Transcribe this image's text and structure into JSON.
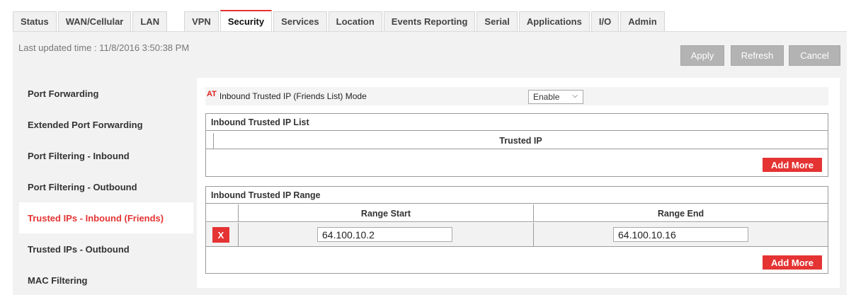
{
  "tabs": [
    {
      "label": "Status"
    },
    {
      "label": "WAN/Cellular"
    },
    {
      "label": "LAN"
    },
    {
      "label": "VPN"
    },
    {
      "label": "Security"
    },
    {
      "label": "Services"
    },
    {
      "label": "Location"
    },
    {
      "label": "Events Reporting"
    },
    {
      "label": "Serial"
    },
    {
      "label": "Applications"
    },
    {
      "label": "I/O"
    },
    {
      "label": "Admin"
    }
  ],
  "header": {
    "last_updated": "Last updated time : 11/8/2016 3:50:38 PM",
    "apply_label": "Apply",
    "refresh_label": "Refresh",
    "cancel_label": "Cancel"
  },
  "sidebar": {
    "items": [
      {
        "label": "Port Forwarding"
      },
      {
        "label": "Extended Port Forwarding"
      },
      {
        "label": "Port Filtering - Inbound"
      },
      {
        "label": "Port Filtering - Outbound"
      },
      {
        "label": "Trusted IPs - Inbound (Friends)"
      },
      {
        "label": "Trusted IPs - Outbound"
      },
      {
        "label": "MAC Filtering"
      }
    ]
  },
  "main": {
    "mode": {
      "badge": "AT",
      "label": "Inbound Trusted IP (Friends List) Mode",
      "value": "Enable"
    },
    "ip_list": {
      "title": "Inbound Trusted IP List",
      "column": "Trusted IP",
      "add_label": "Add More"
    },
    "ip_range": {
      "title": "Inbound Trusted IP Range",
      "col_start": "Range Start",
      "col_end": "Range End",
      "rows": [
        {
          "delete_label": "X",
          "start": "64.100.10.2",
          "end": "64.100.10.16"
        }
      ],
      "add_label": "Add More"
    }
  },
  "colors": {
    "accent": "#e53333",
    "band": "#f2f2f2",
    "button_gray": "#b3b3b3"
  }
}
